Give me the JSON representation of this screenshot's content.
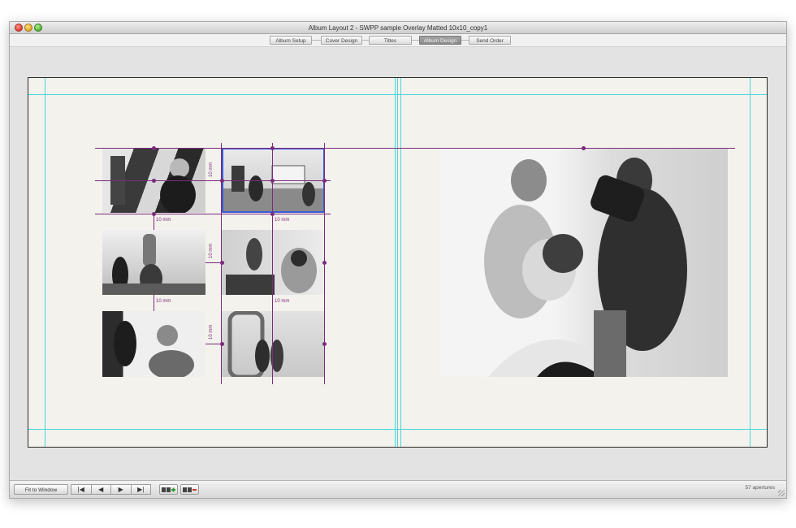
{
  "window": {
    "title": "Album Layout 2 - SWPP sample Overlay Matted 10x10_copy1"
  },
  "tabs": [
    {
      "label": "Album Setup",
      "active": false
    },
    {
      "label": "Cover Design",
      "active": false
    },
    {
      "label": "Titles",
      "active": false
    },
    {
      "label": "Album Design",
      "active": true
    },
    {
      "label": "Send Order",
      "active": false
    }
  ],
  "spacing_labels": {
    "v1": "10 mm",
    "v2": "10 mm",
    "v3": "10 mm",
    "h1": "10 mm",
    "h2": "10 mm",
    "h3": "10 mm",
    "h4": "10 mm"
  },
  "bottom_bar": {
    "fit_to_window": "Fit to Window",
    "first_icon": "first-page-icon",
    "prev_icon": "previous-page-icon",
    "next_icon": "next-page-icon",
    "last_icon": "last-page-icon",
    "add_spread_icon": "add-spread-icon",
    "remove_spread_icon": "remove-spread-icon",
    "status": "57 apertures"
  },
  "colors": {
    "guide": "#49d6dc",
    "aperture_line": "#7b2a7e",
    "selection": "#3b5bd6",
    "active_tab": "#969696"
  }
}
